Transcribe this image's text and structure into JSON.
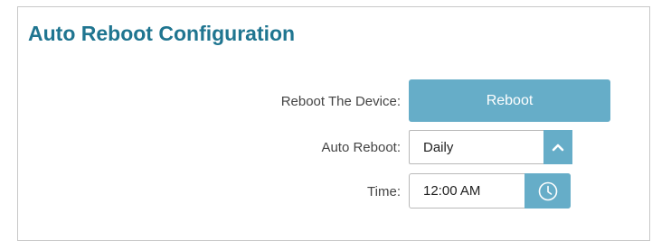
{
  "section": {
    "title": "Auto Reboot Configuration"
  },
  "reboot_device": {
    "label": "Reboot The Device:",
    "button_label": "Reboot"
  },
  "auto_reboot": {
    "label": "Auto Reboot:",
    "selected_value": "Daily",
    "arrow_icon": "chevron-up-icon"
  },
  "time": {
    "label": "Time:",
    "value": "12:00 AM",
    "icon": "clock-icon"
  },
  "colors": {
    "title": "#1f7590",
    "accent": "#66adc8",
    "label_text": "#444444",
    "border": "#b9b9b9"
  }
}
